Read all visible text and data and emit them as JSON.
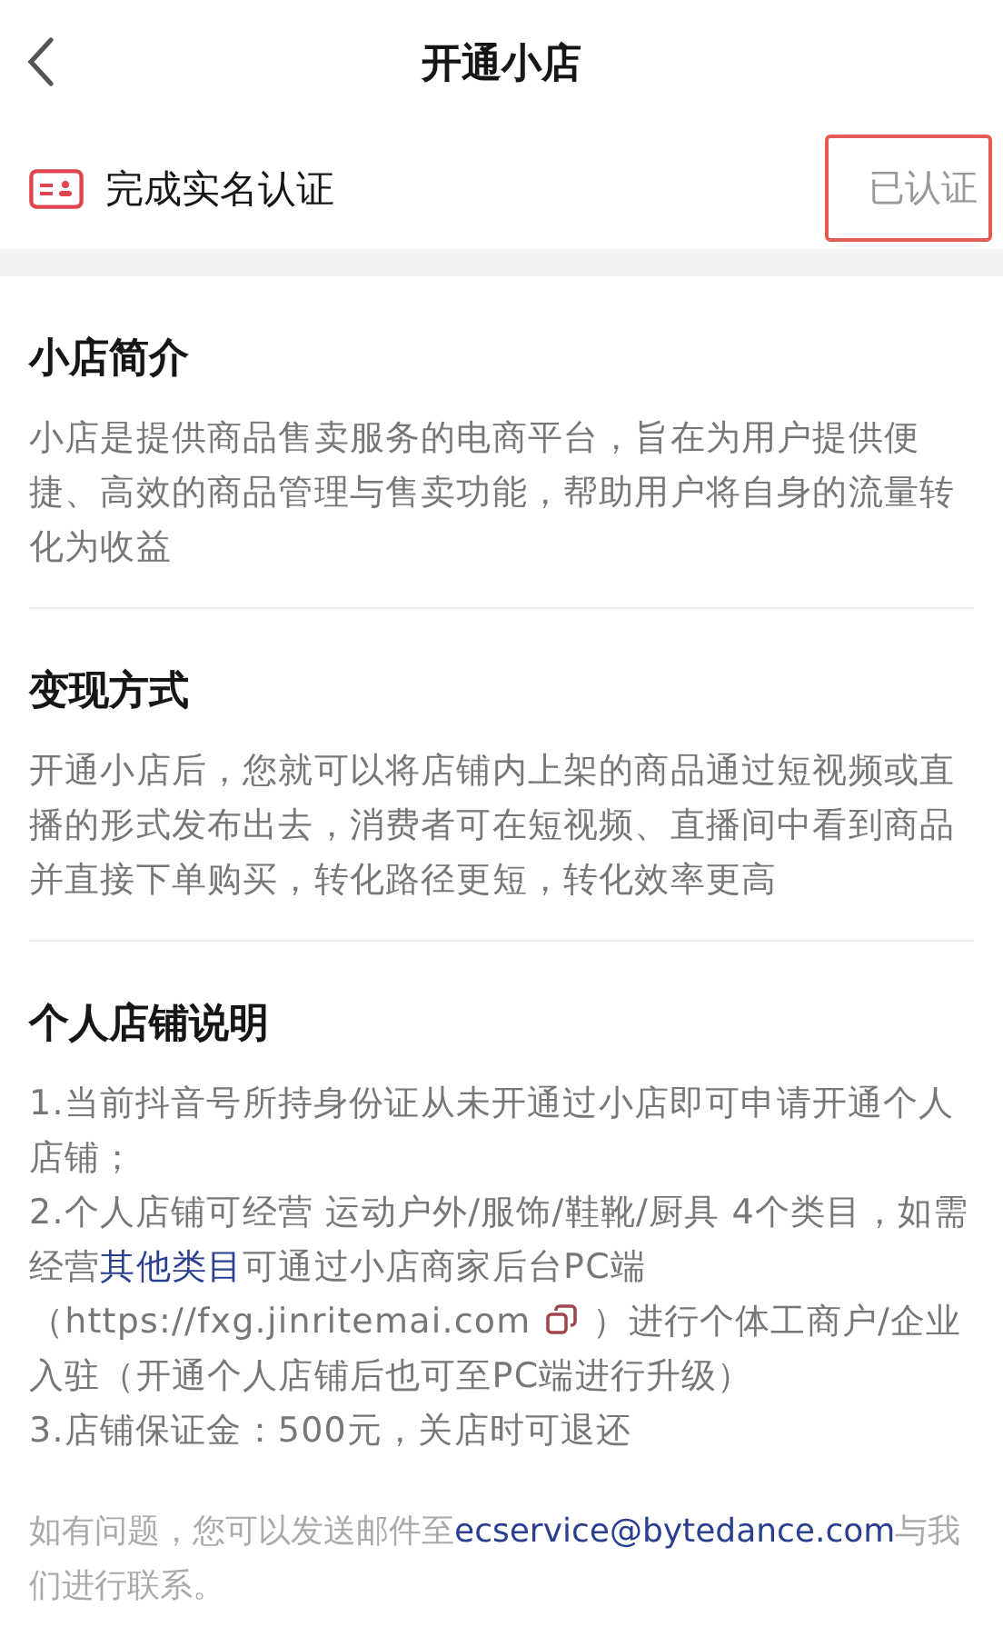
{
  "header": {
    "title": "开通小店"
  },
  "verification": {
    "label": "完成实名认证",
    "status": "已认证",
    "highlighted": true
  },
  "sections": [
    {
      "title": "小店简介",
      "paragraphs": [
        [
          {
            "kind": "text",
            "text": "小店是提供商品售卖服务的电商平台，旨在为用户提供便捷、高效的商品管理与售卖功能，帮助用户将自身的流量转化为收益"
          }
        ]
      ]
    },
    {
      "title": "变现方式",
      "paragraphs": [
        [
          {
            "kind": "text",
            "text": "开通小店后，您就可以将店铺内上架的商品通过短视频或直播的形式发布出去，消费者可在短视频、直播间中看到商品并直接下单购买，转化路径更短，转化效率更高"
          }
        ]
      ]
    },
    {
      "title": "个人店铺说明",
      "paragraphs": [
        [
          {
            "kind": "text",
            "text": "1.当前抖音号所持身份证从未开通过小店即可申请开通个人店铺；"
          }
        ],
        [
          {
            "kind": "text",
            "text": "2.个人店铺可经营 运动户外/服饰/鞋靴/厨具 4个类目，如需经营"
          },
          {
            "kind": "link",
            "text": "其他类目"
          },
          {
            "kind": "text",
            "text": "可通过小店商家后台PC端（https://fxg.jinritemai.com"
          },
          {
            "kind": "copy_icon"
          },
          {
            "kind": "text",
            "text": "）进行个体工商户/企业入驻（开通个人店铺后也可至PC端进行升级）"
          }
        ],
        [
          {
            "kind": "text",
            "text": "3.店铺保证金：500元，关店时可退还"
          }
        ]
      ]
    }
  ],
  "footer": [
    {
      "kind": "text",
      "text": "如有问题，您可以发送邮件至"
    },
    {
      "kind": "link",
      "text": "ecservice@bytedance.com"
    },
    {
      "kind": "text",
      "text": "与我们进行联系。"
    }
  ]
}
